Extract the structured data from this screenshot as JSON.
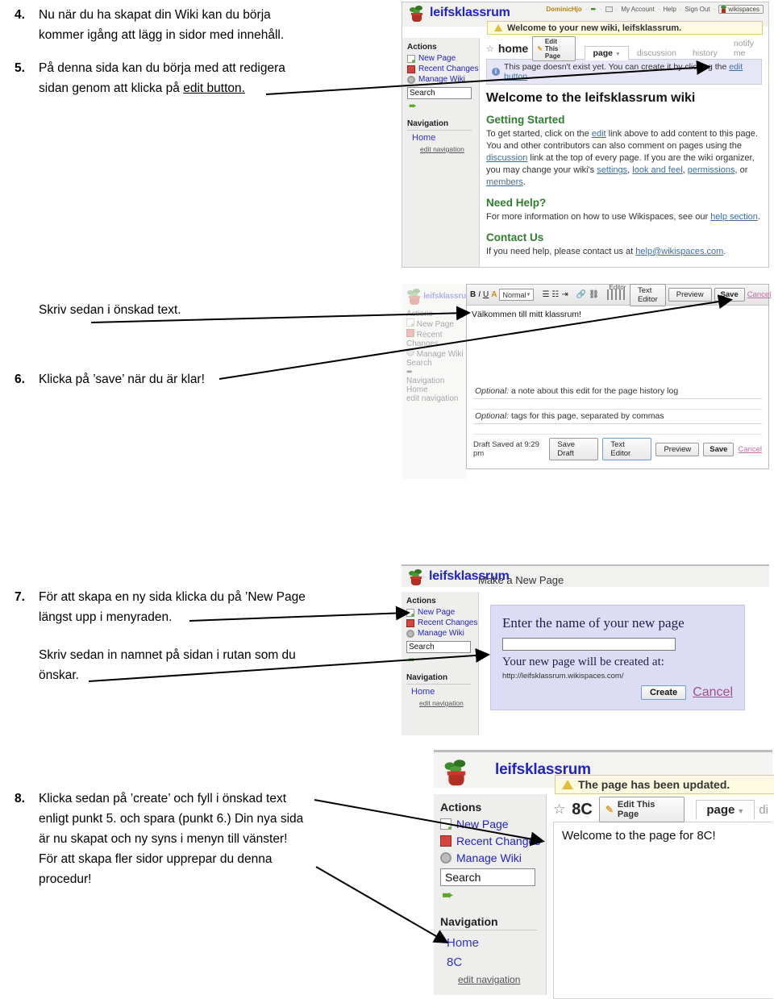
{
  "document": {
    "language": "sv",
    "steps": [
      {
        "number": "4.",
        "lines": [
          "Nu när du ha skapat din Wiki kan du börja",
          "kommer igång att lägg in sidor med innehåll."
        ]
      },
      {
        "number": "5.",
        "lines": [
          "På denna sida kan du börja med att redigera",
          "sidan genom att klicka på "
        ],
        "emphasis": "edit button."
      },
      {
        "number": "",
        "lines": [
          "Skriv sedan i önskad text."
        ]
      },
      {
        "number": "6.",
        "lines": [
          "Klicka på ’save’ när du är klar!"
        ]
      },
      {
        "number": "7.",
        "lines": [
          "För att skapa en ny sida klicka du på ’New Page",
          "längst upp i menyraden."
        ]
      },
      {
        "number": "",
        "lines": [
          "Skriv sedan in namnet på sidan i rutan som du",
          "önskar."
        ]
      },
      {
        "number": "8.",
        "lines": [
          "Klicka sedan på ’create’ och fyll i önskad text",
          "enligt punkt 5. och spara (punkt 6.) Din nya sida",
          "är nu skapat och ny syns i menyn till vänster!",
          "För att skapa fler sidor upprepar du denna",
          "procedur!"
        ]
      }
    ]
  },
  "shot_home": {
    "wiki_name": "leifsklassrum",
    "userbar": {
      "username": "DominicHjo",
      "links": [
        "My Account",
        "Help",
        "Sign Out"
      ],
      "brand_button": "wikispaces"
    },
    "notice": "Welcome to your new wiki, leifsklassrum.",
    "sidebar": {
      "actions_heading": "Actions",
      "actions": [
        "New Page",
        "Recent Changes",
        "Manage Wiki"
      ],
      "search_value": "Search",
      "navigation_heading": "Navigation",
      "nav_links": [
        "Home"
      ],
      "edit_navigation": "edit navigation"
    },
    "page_title": "home",
    "edit_button": "Edit This Page",
    "tabs": [
      "page",
      "discussion",
      "history",
      "notify me"
    ],
    "active_tab": "page",
    "info_prefix": "This page doesn't exist yet. You can create it by clicking the ",
    "info_link": "edit button",
    "heading": "Welcome to the leifsklassrum wiki",
    "sections": [
      {
        "title": "Getting Started",
        "text_parts": [
          "To get started, click on the ",
          "edit",
          " link above to add content to this page. You and other contributors can also comment on pages using the ",
          "discussion",
          " link at the top of every page. If you are the wiki organizer, you may change your wiki's ",
          "settings",
          ", ",
          "look and feel",
          ", ",
          "permissions",
          ", or ",
          "members",
          "."
        ]
      },
      {
        "title": "Need Help?",
        "text_parts": [
          "For more information on how to use Wikispaces, see our ",
          "help section",
          "."
        ]
      },
      {
        "title": "Contact Us",
        "text_parts": [
          "If you need help, please contact us at ",
          "help@wikispaces.com",
          "."
        ]
      }
    ]
  },
  "shot_editor": {
    "wiki_name": "leifsklassru",
    "sidebar": {
      "actions_heading": "Actions",
      "actions": [
        "New Page",
        "Recent Changes",
        "Manage Wiki"
      ],
      "search_value": "Search",
      "navigation_heading": "Navigation",
      "nav_links": [
        "Home"
      ],
      "edit_navigation": "edit navigation"
    },
    "editor_label": "Editor",
    "style_select": "Normal",
    "toolbar_buttons": [
      "B",
      "I",
      "U",
      "A"
    ],
    "buttons": {
      "text_editor": "Text Editor",
      "preview": "Preview",
      "save": "Save",
      "cancel": "Cancel",
      "save_draft": "Save Draft"
    },
    "content": "Välkommen till mitt klassrum!",
    "optional_note": "a note about this edit for the page history log",
    "optional_tags": "tags for this page, separated by commas",
    "optional_label": "Optional:",
    "draft_status": "Draft Saved at 9:29 pm"
  },
  "shot_newpage": {
    "wiki_name": "leifsklassrum",
    "page_title": "Make a New Page",
    "sidebar": {
      "actions_heading": "Actions",
      "actions": [
        "New Page",
        "Recent Changes",
        "Manage Wiki"
      ],
      "search_value": "Search",
      "navigation_heading": "Navigation",
      "nav_links": [
        "Home"
      ],
      "edit_navigation": "edit navigation"
    },
    "prompt": "Enter the name of your new page",
    "name_value": "",
    "subprompt": "Your new page will be created at:",
    "url": "http://leifsklassrum.wikispaces.com/",
    "create_button": "Create",
    "cancel_link": "Cancel"
  },
  "shot_updated": {
    "wiki_name": "leifsklassrum",
    "notice": "The page has been updated.",
    "sidebar": {
      "actions_heading": "Actions",
      "actions": [
        "New Page",
        "Recent Changes",
        "Manage Wiki"
      ],
      "search_value": "Search",
      "navigation_heading": "Navigation",
      "nav_links": [
        "Home",
        "8C"
      ],
      "edit_navigation": "edit navigation"
    },
    "page_title": "8C",
    "edit_button": "Edit This Page",
    "tabs": [
      "page",
      "di"
    ],
    "active_tab": "page",
    "content": "Welcome to the page for 8C!"
  },
  "colors": {
    "link": "#2222cc",
    "heading_green": "#2f7d2f",
    "notice_bg": "#fdfbdf",
    "info_bg": "#e6e6f7",
    "newpage_bg": "#dcdcf5",
    "sidebar_bg": "#eeeeec"
  }
}
